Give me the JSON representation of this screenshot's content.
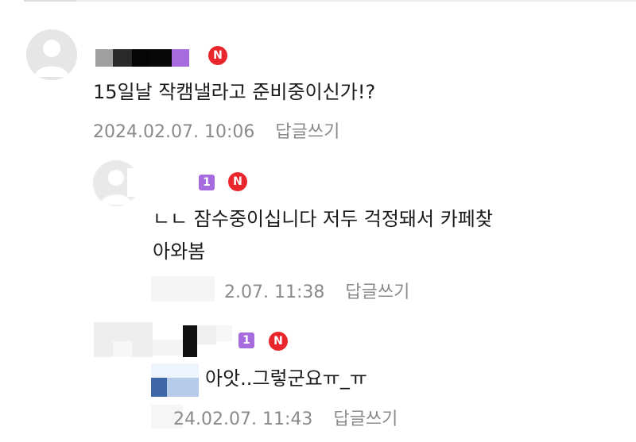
{
  "comments": [
    {
      "text": "15일날 작캠낼라고 준비중이신가!?",
      "date": "2024.02.07. 10:06",
      "reply_label": "답글쓰기",
      "new_badge": "N"
    },
    {
      "level_badge": "1",
      "new_badge": "N",
      "text_line1": "ㄴㄴ 잠수중이십니다 저두 걱정돼서 카페찾",
      "text_line2": "아와봄",
      "date": "2.07. 11:38",
      "reply_label": "답글쓰기"
    },
    {
      "level_badge": "1",
      "new_badge": "N",
      "text": "아앗..그렇군요ㅠ_ㅠ",
      "date": "24.02.07. 11:43",
      "reply_label": "답글쓰기"
    }
  ],
  "colors": {
    "new_badge": "#e9262c",
    "level_badge": "#a66cde",
    "meta_text": "#8a8a8a"
  }
}
